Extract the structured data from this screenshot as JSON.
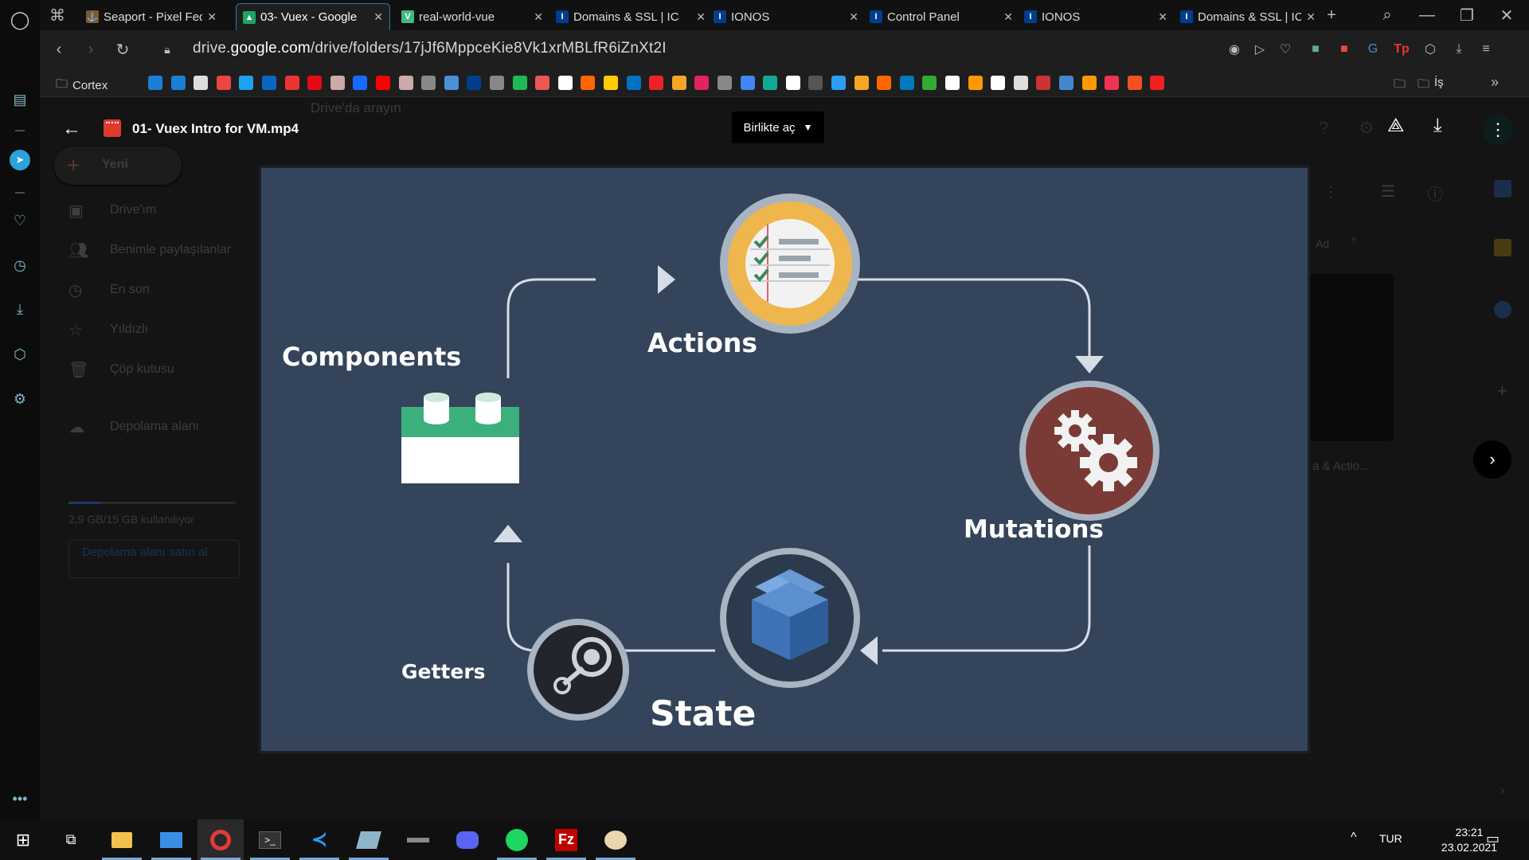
{
  "tabs": [
    {
      "title": "Seaport - Pixel Fed",
      "fav_color": "#7a5a3a",
      "fav_glyph": "⚓",
      "active": false
    },
    {
      "title": "03- Vuex - Google",
      "fav_color": "#1fa463",
      "fav_glyph": "▲",
      "active": true
    },
    {
      "title": "real-world-vue",
      "fav_color": "#41b883",
      "fav_glyph": "V",
      "active": false
    },
    {
      "title": "Domains & SSL | IC",
      "fav_color": "#003d8f",
      "fav_glyph": "I",
      "active": false
    },
    {
      "title": "IONOS",
      "fav_color": "#003d8f",
      "fav_glyph": "I",
      "active": false
    },
    {
      "title": "Control Panel",
      "fav_color": "#003d8f",
      "fav_glyph": "I",
      "active": false
    },
    {
      "title": "IONOS",
      "fav_color": "#003d8f",
      "fav_glyph": "I",
      "active": false
    },
    {
      "title": "Domains & SSL | IC",
      "fav_color": "#003d8f",
      "fav_glyph": "I",
      "active": false
    }
  ],
  "address": {
    "url_prefix": "drive.",
    "url_host": "google.com",
    "url_path": "/drive/folders/17jJf6MppceKie8Vk1xrMBLfR6iZnXt2I"
  },
  "bookmarks": {
    "first_folder": "Cortex",
    "last_folder": "İş"
  },
  "drive": {
    "search_placeholder": "Drive'da arayın",
    "new_button": "Yeni",
    "nav": [
      "Drive'ım",
      "Benimle paylaşılanlar",
      "En son",
      "Yıldızlı",
      "Çöp kutusu"
    ],
    "storage_label": "Depolama alanı",
    "storage_used": "2,9 GB/15 GB kullanılıyor",
    "storage_buy": "Depolama alanı satın al",
    "sort_label": "Ad",
    "file_card_label": "a & Actio..."
  },
  "viewer": {
    "file_title": "01- Vuex Intro for VM.mp4",
    "open_with_label": "Birlikte aç"
  },
  "slide": {
    "components": "Components",
    "actions": "Actions",
    "mutations": "Mutations",
    "state": "State",
    "getters": "Getters"
  },
  "taskbar": {
    "language": "TUR",
    "time": "23:21",
    "date": "23.02.2021"
  }
}
